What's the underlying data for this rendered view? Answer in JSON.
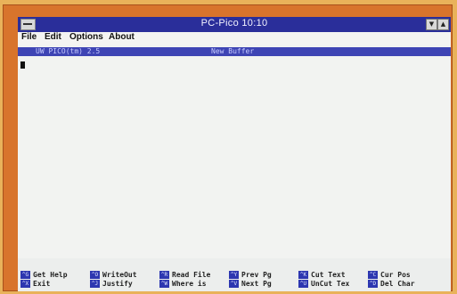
{
  "window": {
    "title": "PC-Pico  10:10",
    "minimize_glyph": "▼",
    "maximize_glyph": "▲"
  },
  "menu": {
    "items": [
      "File",
      "Edit",
      "Options",
      "About"
    ]
  },
  "editor": {
    "version": "UW PICO(tm) 2.5",
    "buffer_name": "New Buffer"
  },
  "shortcuts": [
    {
      "key": "^G",
      "label": "Get Help"
    },
    {
      "key": "^O",
      "label": "WriteOut"
    },
    {
      "key": "^R",
      "label": "Read File"
    },
    {
      "key": "^Y",
      "label": "Prev Pg"
    },
    {
      "key": "^K",
      "label": "Cut Text"
    },
    {
      "key": "^C",
      "label": "Cur Pos"
    },
    {
      "key": "^X",
      "label": "Exit"
    },
    {
      "key": "^J",
      "label": "Justify"
    },
    {
      "key": "^W",
      "label": "Where is"
    },
    {
      "key": "^V",
      "label": "Next Pg"
    },
    {
      "key": "^U",
      "label": "UnCut Tex"
    },
    {
      "key": "^D",
      "label": "Del Char"
    }
  ],
  "colors": {
    "titlebar": "#2a2e9a",
    "statusline": "#3e44b4",
    "key_badge": "#2d37b0",
    "frame": "#d8742c"
  }
}
